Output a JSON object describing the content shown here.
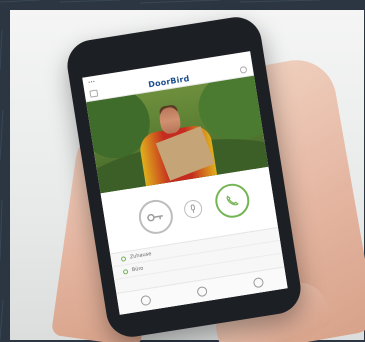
{
  "app": {
    "brand": "DoorBird",
    "carrier": "•••",
    "time": "",
    "battery": ""
  },
  "list": {
    "items": [
      {
        "label": "Zuhause"
      },
      {
        "label": "Büro"
      }
    ]
  },
  "icons": {
    "key": "key-icon",
    "mic": "microphone-icon",
    "call": "phone-icon",
    "tab_left": "door-icon",
    "tab_mid": "history-icon",
    "tab_right": "settings-icon"
  },
  "colors": {
    "brand_blue": "#1f4f8f",
    "accent_green": "#74b554",
    "phone_body": "#1c1f23"
  }
}
